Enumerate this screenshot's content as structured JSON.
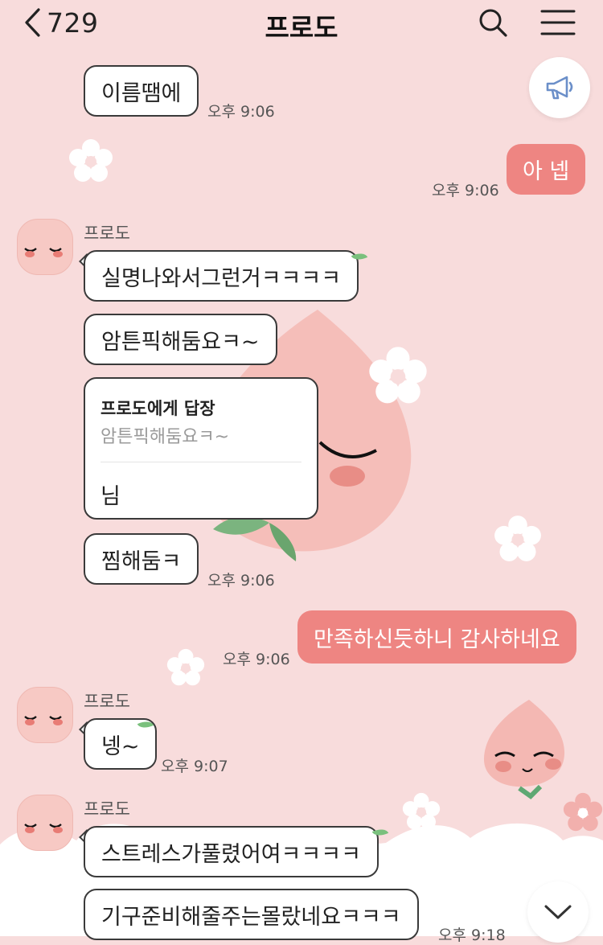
{
  "header": {
    "back_count": "729",
    "title": "프로도"
  },
  "messages": [
    {
      "side": "in",
      "text": "이름땜에",
      "time": "오후 9:06"
    },
    {
      "side": "out",
      "text": "아 넵",
      "time": "오후 9:06"
    },
    {
      "side": "in",
      "sender": "프로도",
      "text": "실명나와서그런거ㅋㅋㅋㅋ"
    },
    {
      "side": "in",
      "text": "암튼픽해둠요ㅋ~"
    },
    {
      "side": "in",
      "type": "reply",
      "reply_to": "프로도에게 답장",
      "quoted": "암튼픽해둠요ㅋ~",
      "text": "님"
    },
    {
      "side": "in",
      "text": "찜해둠ㅋ",
      "time": "오후 9:06"
    },
    {
      "side": "out",
      "text": "만족하신듯하니 감사하네요",
      "time": "오후 9:06"
    },
    {
      "side": "in",
      "sender": "프로도",
      "text": "넹~",
      "time": "오후 9:07"
    },
    {
      "side": "in",
      "sender": "프로도",
      "text": "스트레스가풀렸어여ㅋㅋㅋㅋ"
    },
    {
      "side": "in",
      "text": "기구준비해줄주는몰랐네요ㅋㅋㅋ",
      "time": "오후 9:18"
    }
  ],
  "colors": {
    "background": "#f8dcdc",
    "my_bubble": "#ee8582",
    "notice_icon": "#6b8fc9"
  },
  "icons": [
    "chevron-left-icon",
    "search-icon",
    "menu-icon",
    "megaphone-icon",
    "chevron-down-icon"
  ]
}
